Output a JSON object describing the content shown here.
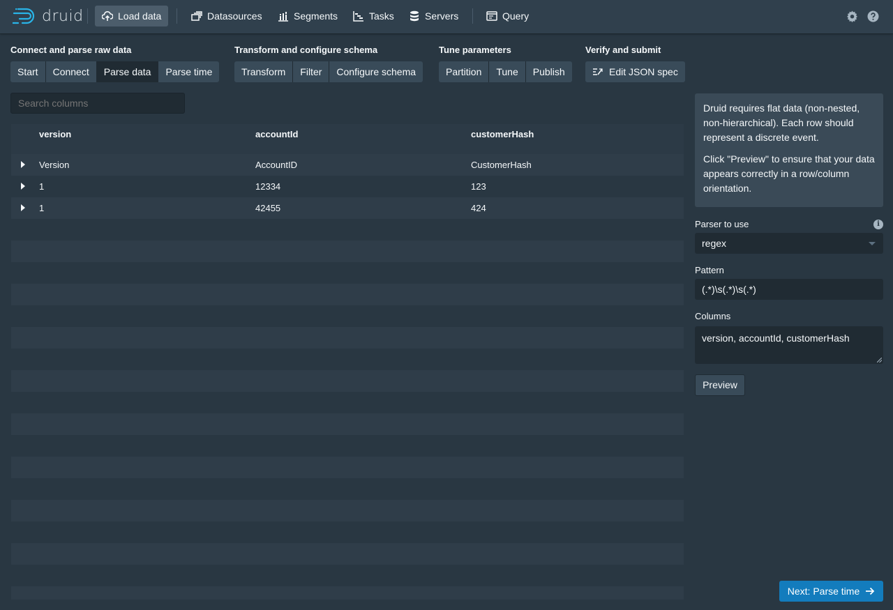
{
  "app": {
    "logo_text": "druid"
  },
  "nav": {
    "load_data": "Load data",
    "datasources": "Datasources",
    "segments": "Segments",
    "tasks": "Tasks",
    "servers": "Servers",
    "query": "Query"
  },
  "steps": {
    "connect_group": {
      "title": "Connect and parse raw data",
      "buttons": [
        "Start",
        "Connect",
        "Parse data",
        "Parse time"
      ]
    },
    "transform_group": {
      "title": "Transform and configure schema",
      "buttons": [
        "Transform",
        "Filter",
        "Configure schema"
      ]
    },
    "tune_group": {
      "title": "Tune parameters",
      "buttons": [
        "Partition",
        "Tune",
        "Publish"
      ]
    },
    "verify_group": {
      "title": "Verify and submit",
      "buttons": [
        "Edit JSON spec"
      ]
    },
    "active": "Parse data"
  },
  "search": {
    "placeholder": "Search columns"
  },
  "table": {
    "columns": [
      "version",
      "accountId",
      "customerHash"
    ],
    "rows": [
      [
        "Version",
        "AccountID",
        "CustomerHash"
      ],
      [
        "1",
        "12334",
        "123"
      ],
      [
        "1",
        "42455",
        "424"
      ]
    ]
  },
  "panel": {
    "callout_p1": "Druid requires flat data (non-nested, non-hierarchical). Each row should represent a discrete event.",
    "callout_p2": "Click \"Preview\" to ensure that your data appears correctly in a row/column orientation.",
    "parser_label": "Parser to use",
    "parser_value": "regex",
    "pattern_label": "Pattern",
    "pattern_value": "(.*)\\s(.*)\\s(.*)",
    "columns_label": "Columns",
    "columns_value": "version, accountId, customerHash",
    "preview_label": "Preview",
    "next_label": "Next: Parse time"
  },
  "colors": {
    "accent": "#137cbd",
    "background": "#293742",
    "navbar": "#30404d"
  }
}
